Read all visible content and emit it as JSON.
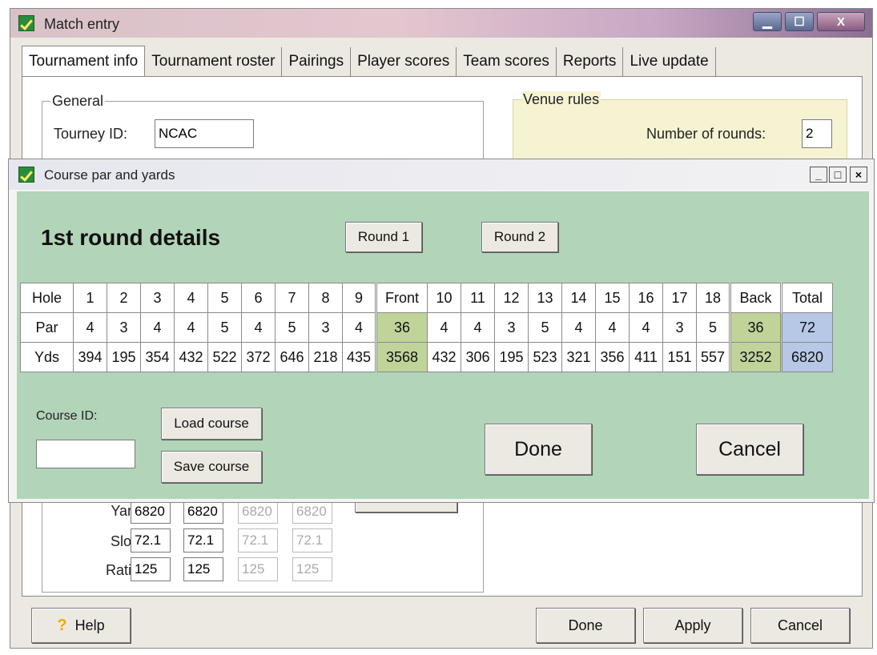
{
  "window": {
    "title": "Match entry",
    "controls": {
      "minimize": "▁",
      "maximize": "☐",
      "close": "X"
    }
  },
  "tabs": [
    {
      "label": "Tournament info",
      "active": true
    },
    {
      "label": "Tournament roster",
      "active": false
    },
    {
      "label": "Pairings",
      "active": false
    },
    {
      "label": "Player scores",
      "active": false
    },
    {
      "label": "Team scores",
      "active": false
    },
    {
      "label": "Reports",
      "active": false
    },
    {
      "label": "Live update",
      "active": false
    }
  ],
  "general": {
    "group_label": "General",
    "tourney_id_label": "Tourney ID:",
    "tourney_id_value": "NCAC"
  },
  "venue_rules": {
    "group_label": "Venue rules",
    "rounds_label": "Number of rounds:",
    "rounds_value": "2"
  },
  "course_stats": {
    "yards_label": "Yards:",
    "slope_label": "Slope:",
    "rating_label": "Rating:",
    "yards": [
      "6820",
      "6820",
      "6820",
      "6820"
    ],
    "slope": [
      "72.1",
      "72.1",
      "72.1",
      "72.1"
    ],
    "rating": [
      "125",
      "125",
      "125",
      "125"
    ]
  },
  "dialog": {
    "title": "Course par and yards",
    "controls": {
      "minimize": "_",
      "maximize": "□",
      "close": "×"
    },
    "heading": "1st round details",
    "round1_button": "Round 1",
    "round2_button": "Round 2",
    "grid": {
      "headers": [
        "Hole",
        "1",
        "2",
        "3",
        "4",
        "5",
        "6",
        "7",
        "8",
        "9",
        "Front",
        "10",
        "11",
        "12",
        "13",
        "14",
        "15",
        "16",
        "17",
        "18",
        "Back",
        "Total"
      ],
      "par_label": "Par",
      "yds_label": "Yds",
      "par": [
        "4",
        "3",
        "4",
        "4",
        "5",
        "4",
        "5",
        "3",
        "4",
        "36",
        "4",
        "4",
        "3",
        "5",
        "4",
        "4",
        "4",
        "3",
        "5",
        "36",
        "72"
      ],
      "yds": [
        "394",
        "195",
        "354",
        "432",
        "522",
        "372",
        "646",
        "218",
        "435",
        "3568",
        "432",
        "306",
        "195",
        "523",
        "321",
        "356",
        "411",
        "151",
        "557",
        "3252",
        "6820"
      ]
    },
    "course_id_label": "Course ID:",
    "course_id_value": "",
    "load_course_button": "Load course",
    "save_course_button": "Save course",
    "done_button": "Done",
    "cancel_button": "Cancel"
  },
  "footer": {
    "help_button": "Help",
    "done_button": "Done",
    "apply_button": "Apply",
    "cancel_button": "Cancel"
  }
}
